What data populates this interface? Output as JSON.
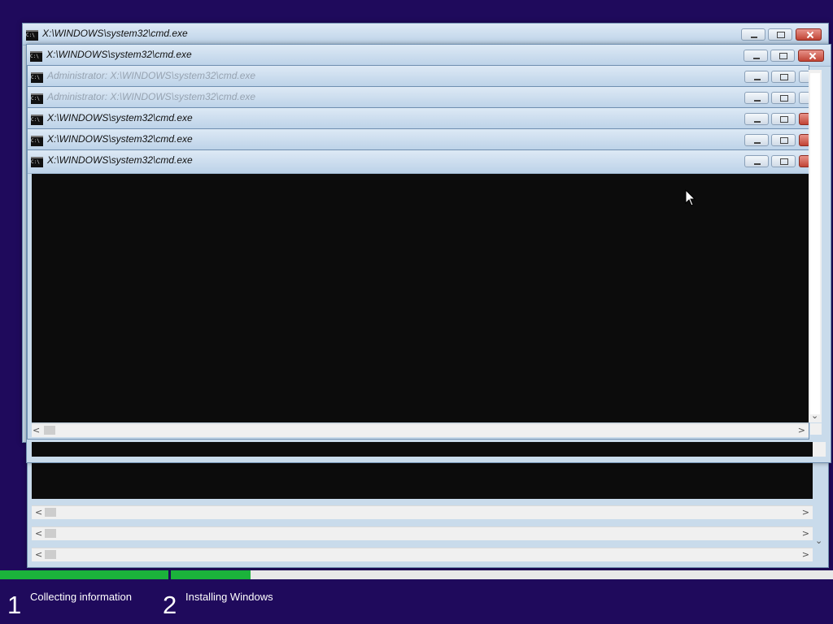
{
  "windows": [
    {
      "title": "X:\\WINDOWS\\system32\\cmd.exe",
      "state": "active"
    },
    {
      "title": "X:\\WINDOWS\\system32\\cmd.exe",
      "state": "active"
    },
    {
      "title": "Administrator: X:\\WINDOWS\\system32\\cmd.exe",
      "state": "inactive"
    },
    {
      "title": "Administrator: X:\\WINDOWS\\system32\\cmd.exe",
      "state": "inactive"
    },
    {
      "title": "X:\\WINDOWS\\system32\\cmd.exe",
      "state": "active"
    },
    {
      "title": "X:\\WINDOWS\\system32\\cmd.exe",
      "state": "active"
    },
    {
      "title": "X:\\WINDOWS\\system32\\cmd.exe",
      "state": "active"
    }
  ],
  "icons": {
    "console": "cmd-console-icon",
    "minimize": "minimize-icon",
    "maximize": "maximize-icon",
    "close": "close-icon",
    "cursor": "mouse-pointer-icon"
  },
  "setup": {
    "steps": [
      {
        "number": "1",
        "label": "Collecting information",
        "progress": 1.0
      },
      {
        "number": "2",
        "label": "Installing Windows",
        "progress": 0.12
      }
    ]
  },
  "colors": {
    "desktop": "#1f0a5c",
    "progress": "#1bb33b",
    "console": "#0c0c0c"
  }
}
